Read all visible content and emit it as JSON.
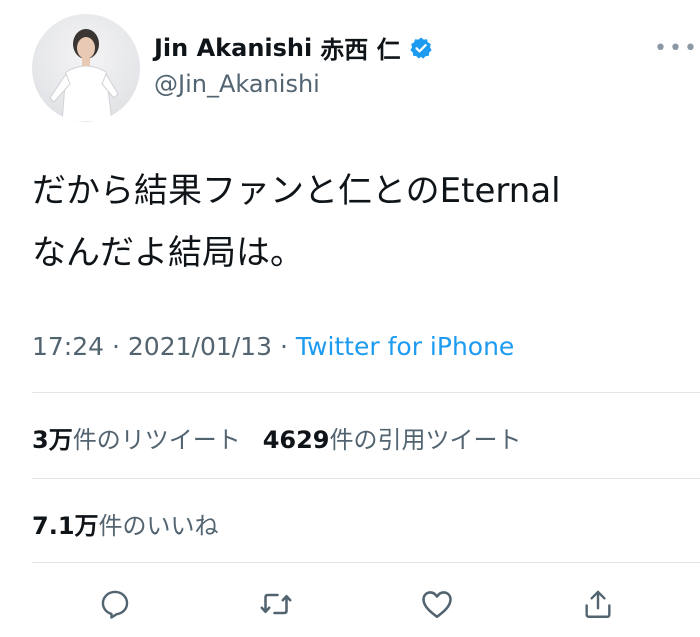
{
  "author": {
    "name": "Jin Akanishi",
    "name_jp": "赤西 仁",
    "handle": "@Jin_Akanishi",
    "verified_icon": "verified-badge-icon",
    "verified_color": "#1d9bf0"
  },
  "tweet": {
    "lines": [
      "だから結果ファンと仁とのEternal",
      "なんだよ結局は。"
    ]
  },
  "meta": {
    "time": "17:24",
    "separator": "·",
    "date": "2021/01/13",
    "source": "Twitter for iPhone",
    "link_color": "#1d9bf0"
  },
  "stats": {
    "retweets_count": "3万",
    "retweets_label": "件のリツイート",
    "quotes_count": "4629",
    "quotes_label": "件の引用ツイート",
    "likes_count": "7.1万",
    "likes_label": "件のいいね"
  },
  "actions": [
    {
      "name": "reply",
      "icon": "reply-icon"
    },
    {
      "name": "retweet",
      "icon": "retweet-icon"
    },
    {
      "name": "like",
      "icon": "heart-icon"
    },
    {
      "name": "share",
      "icon": "share-icon"
    }
  ],
  "more_icon": "more-options-icon",
  "more_glyph": "•••"
}
